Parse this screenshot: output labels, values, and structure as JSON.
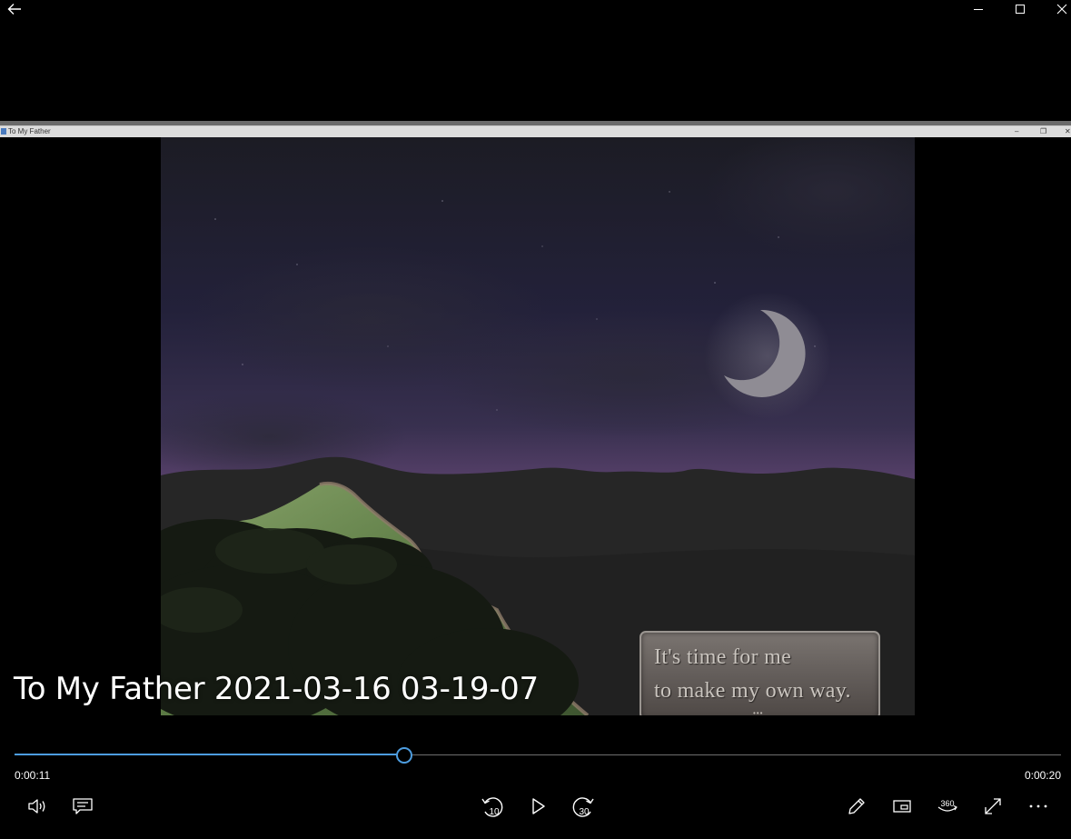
{
  "window": {
    "back_icon": "arrow-left-icon",
    "controls": [
      "minimize-icon",
      "maximize-icon",
      "close-icon"
    ]
  },
  "recorded_window": {
    "title": "To My Father",
    "controls": [
      "minimize-icon",
      "restore-icon",
      "close-icon"
    ]
  },
  "game": {
    "dialog_lines": [
      "It's time for me",
      "to make my own way."
    ],
    "more_indicator": "•••"
  },
  "video": {
    "title": "To My Father 2021-03-16 03-19-07",
    "current_time": "0:00:11",
    "total_time": "0:00:20",
    "progress": 0.372,
    "accent_color": "#4d9de0"
  },
  "controls": {
    "left": [
      "volume-icon",
      "captions-icon"
    ],
    "center": [
      "skip-back-10-icon",
      "play-icon",
      "skip-forward-30-icon"
    ],
    "skip_back_label": "10",
    "skip_forward_label": "30",
    "right": [
      "edit-pencil-icon",
      "mini-view-icon",
      "360-view-icon",
      "fullscreen-icon",
      "more-icon"
    ],
    "label_360": "360"
  }
}
